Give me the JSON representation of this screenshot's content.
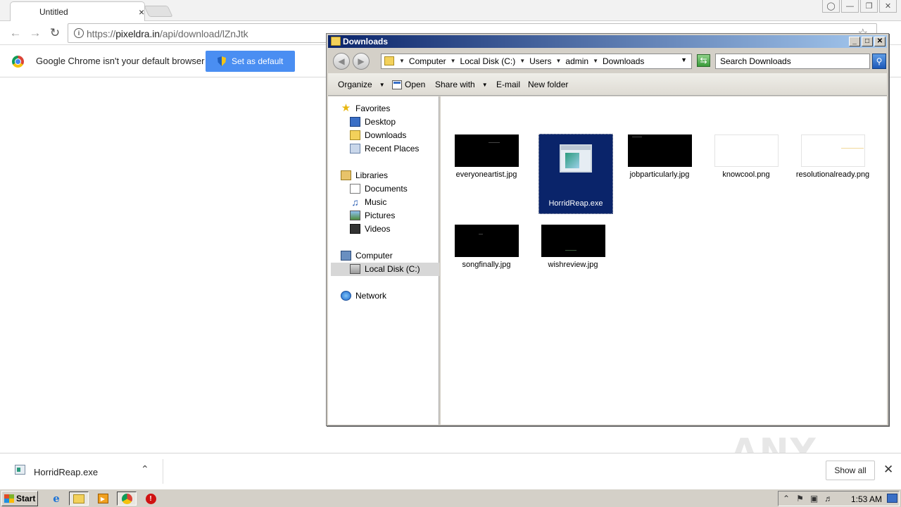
{
  "browser": {
    "tab_title": "Untitled",
    "tab_close": "×",
    "url_scheme": "https://",
    "url_host": "pixeldra.in",
    "url_path": "/api/download/lZnJtk",
    "infobar_text": "Google Chrome isn't your default browser",
    "set_default_label": "Set as default"
  },
  "explorer": {
    "title": "Downloads",
    "breadcrumbs": [
      "Computer",
      "Local Disk (C:)",
      "Users",
      "admin",
      "Downloads"
    ],
    "search_placeholder": "Search Downloads",
    "commands": {
      "organize": "Organize",
      "open": "Open",
      "share_with": "Share with",
      "email": "E-mail",
      "new_folder": "New folder"
    },
    "nav": {
      "favorites": "Favorites",
      "desktop": "Desktop",
      "downloads": "Downloads",
      "recent_places": "Recent Places",
      "libraries": "Libraries",
      "documents": "Documents",
      "music": "Music",
      "pictures": "Pictures",
      "videos": "Videos",
      "computer": "Computer",
      "local_disk": "Local Disk (C:)",
      "network": "Network"
    },
    "files": [
      {
        "name": "everyoneartist.jpg",
        "thumb": "black"
      },
      {
        "name": "HorridReap.exe",
        "thumb": "exe",
        "selected": true
      },
      {
        "name": "jobparticularly.jpg",
        "thumb": "black"
      },
      {
        "name": "knowcool.png",
        "thumb": "white"
      },
      {
        "name": "resolutionalready.png",
        "thumb": "white"
      },
      {
        "name": "songfinally.jpg",
        "thumb": "black"
      },
      {
        "name": "wishreview.jpg",
        "thumb": "black"
      }
    ]
  },
  "download_shelf": {
    "file_name": "HorridReap.exe",
    "show_all": "Show all"
  },
  "taskbar": {
    "start_label": "Start",
    "clock": "1:53 AM"
  },
  "watermark": "ANY RUN"
}
